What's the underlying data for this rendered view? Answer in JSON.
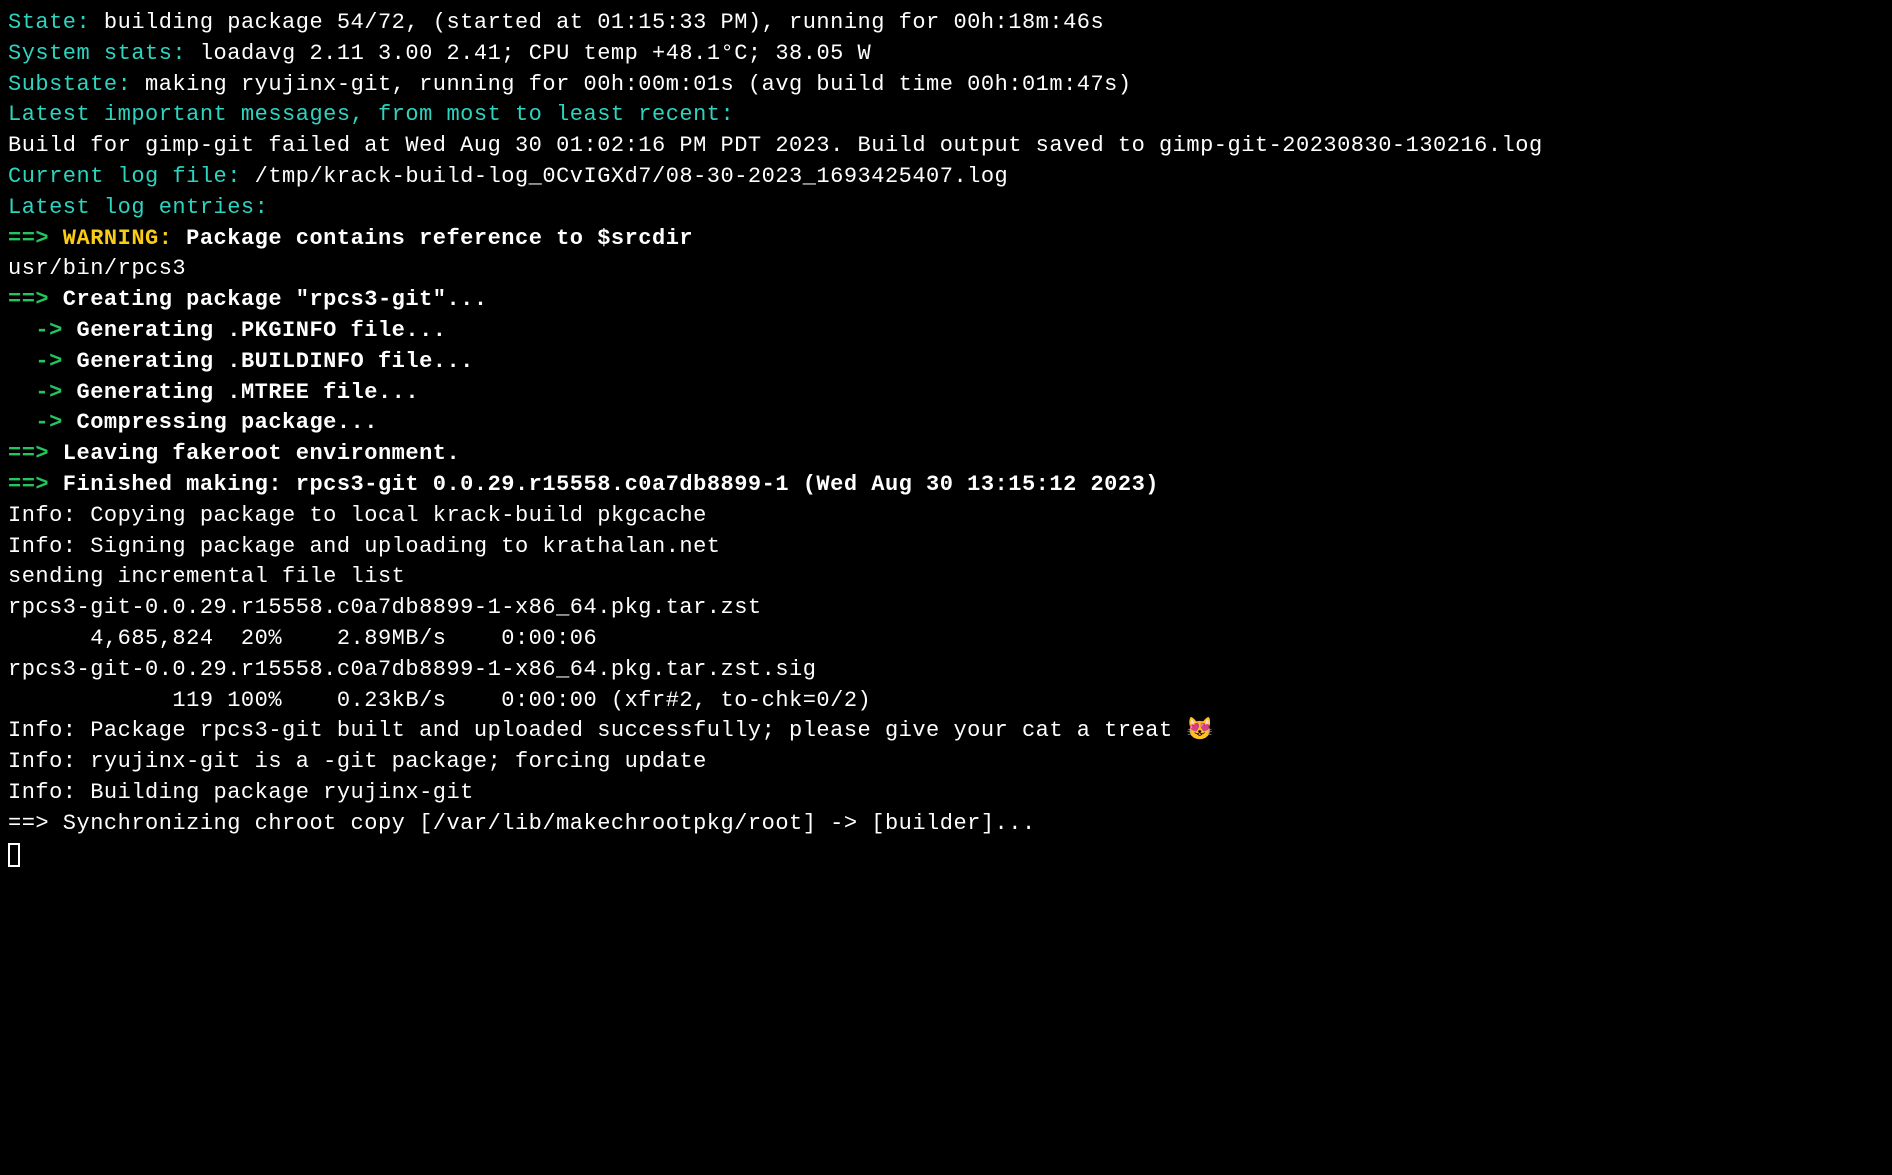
{
  "lines": [
    {
      "segments": [
        {
          "cls": "cyan",
          "text": "State:"
        },
        {
          "cls": "white",
          "text": " building package 54/72, (started at 01:15:33 PM), running for 00h:18m:46s"
        }
      ]
    },
    {
      "segments": [
        {
          "cls": "cyan",
          "text": "System stats:"
        },
        {
          "cls": "white",
          "text": " loadavg 2.11 3.00 2.41; CPU temp +48.1°C; 38.05 W"
        }
      ]
    },
    {
      "segments": [
        {
          "cls": "cyan",
          "text": "Substate:"
        },
        {
          "cls": "white",
          "text": " making ryujinx-git, running for 00h:00m:01s (avg build time 00h:01m:47s)"
        }
      ]
    },
    {
      "segments": [
        {
          "cls": "cyan",
          "text": "Latest important messages, from most to least recent:"
        }
      ]
    },
    {
      "segments": [
        {
          "cls": "white",
          "text": "Build for gimp-git failed at Wed Aug 30 01:02:16 PM PDT 2023. Build output saved to gimp-git-20230830-130216.log"
        }
      ]
    },
    {
      "segments": [
        {
          "cls": "cyan",
          "text": "Current log file:"
        },
        {
          "cls": "white",
          "text": " /tmp/krack-build-log_0CvIGXd7/08-30-2023_1693425407.log"
        }
      ]
    },
    {
      "segments": [
        {
          "cls": "cyan",
          "text": "Latest log entries:"
        }
      ]
    },
    {
      "segments": [
        {
          "cls": "green bold",
          "text": "==>"
        },
        {
          "cls": "yellow bold",
          "text": " WARNING:"
        },
        {
          "cls": "white bold",
          "text": " Package contains reference to $srcdir"
        }
      ]
    },
    {
      "segments": [
        {
          "cls": "white",
          "text": "usr/bin/rpcs3"
        }
      ]
    },
    {
      "segments": [
        {
          "cls": "green bold",
          "text": "==>"
        },
        {
          "cls": "white bold",
          "text": " Creating package \"rpcs3-git\"..."
        }
      ]
    },
    {
      "segments": [
        {
          "cls": "green bold",
          "text": "  ->"
        },
        {
          "cls": "white bold",
          "text": " Generating .PKGINFO file..."
        }
      ]
    },
    {
      "segments": [
        {
          "cls": "green bold",
          "text": "  ->"
        },
        {
          "cls": "white bold",
          "text": " Generating .BUILDINFO file..."
        }
      ]
    },
    {
      "segments": [
        {
          "cls": "green bold",
          "text": "  ->"
        },
        {
          "cls": "white bold",
          "text": " Generating .MTREE file..."
        }
      ]
    },
    {
      "segments": [
        {
          "cls": "green bold",
          "text": "  ->"
        },
        {
          "cls": "white bold",
          "text": " Compressing package..."
        }
      ]
    },
    {
      "segments": [
        {
          "cls": "green bold",
          "text": "==>"
        },
        {
          "cls": "white bold",
          "text": " Leaving fakeroot environment."
        }
      ]
    },
    {
      "segments": [
        {
          "cls": "green bold",
          "text": "==>"
        },
        {
          "cls": "white bold",
          "text": " Finished making: rpcs3-git 0.0.29.r15558.c0a7db8899-1 (Wed Aug 30 13:15:12 2023)"
        }
      ]
    },
    {
      "segments": [
        {
          "cls": "white",
          "text": "Info: Copying package to local krack-build pkgcache"
        }
      ]
    },
    {
      "segments": [
        {
          "cls": "white",
          "text": "Info: Signing package and uploading to krathalan.net"
        }
      ]
    },
    {
      "segments": [
        {
          "cls": "white",
          "text": "sending incremental file list"
        }
      ]
    },
    {
      "segments": [
        {
          "cls": "white",
          "text": "rpcs3-git-0.0.29.r15558.c0a7db8899-1-x86_64.pkg.tar.zst"
        }
      ]
    },
    {
      "segments": [
        {
          "cls": "white",
          "text": "      4,685,824  20%    2.89MB/s    0:00:06"
        }
      ]
    },
    {
      "segments": [
        {
          "cls": "white",
          "text": "rpcs3-git-0.0.29.r15558.c0a7db8899-1-x86_64.pkg.tar.zst.sig"
        }
      ]
    },
    {
      "segments": [
        {
          "cls": "white",
          "text": "            119 100%    0.23kB/s    0:00:00 (xfr#2, to-chk=0/2)"
        }
      ]
    },
    {
      "segments": [
        {
          "cls": "white",
          "text": "Info: Package rpcs3-git built and uploaded successfully; please give your cat a treat 😻"
        }
      ]
    },
    {
      "segments": [
        {
          "cls": "white",
          "text": "Info: ryujinx-git is a -git package; forcing update"
        }
      ]
    },
    {
      "segments": [
        {
          "cls": "white",
          "text": "Info: Building package ryujinx-git"
        }
      ]
    },
    {
      "segments": [
        {
          "cls": "white",
          "text": "==> Synchronizing chroot copy [/var/lib/makechrootpkg/root] -> [builder]..."
        }
      ]
    }
  ]
}
